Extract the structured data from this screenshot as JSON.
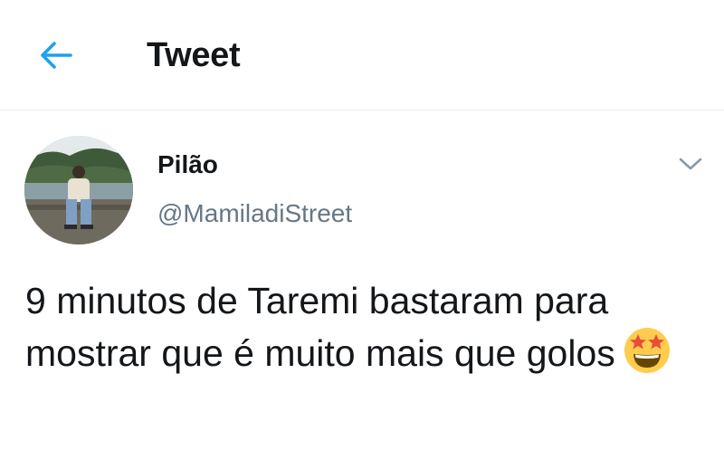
{
  "header": {
    "back_icon": "arrow-left-icon",
    "title": "Tweet"
  },
  "author": {
    "display_name": "Pilão",
    "handle": "@MamiladiStreet",
    "avatar": "avatar-photo"
  },
  "tweet": {
    "text": "9 minutos de Taremi bastaram para mostrar que é muito mais que golos",
    "emoji": "star-struck-emoji",
    "more_icon": "chevron-down-icon"
  },
  "colors": {
    "accent": "#1da1f2",
    "text_primary": "#14171a",
    "text_secondary": "#657786",
    "divider": "#e6ecf0"
  }
}
